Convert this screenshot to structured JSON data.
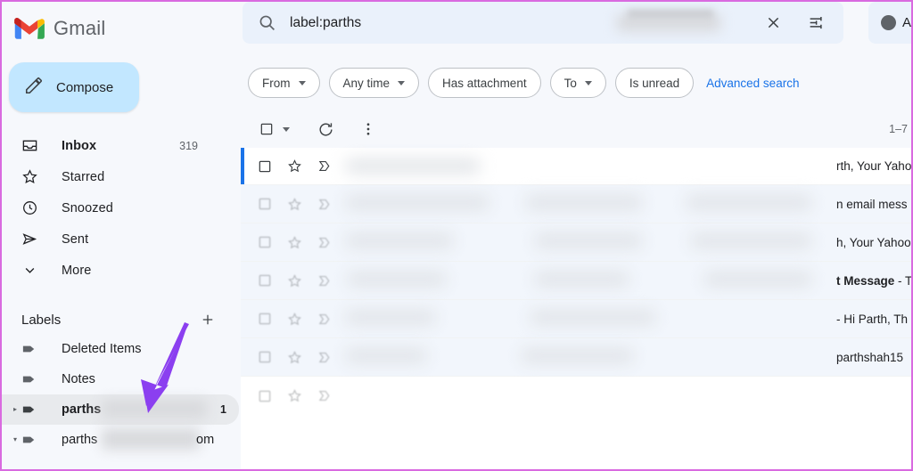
{
  "app": {
    "brand": "Gmail",
    "accent_blue": "#1a73e8",
    "annotation_arrow_color": "#8b3ff0",
    "border_color": "#d96ae0"
  },
  "compose": {
    "label": "Compose",
    "icon": "pencil-icon"
  },
  "sidebar": {
    "nav_items": [
      {
        "label": "Inbox",
        "icon": "inbox-icon",
        "count": "319",
        "active": true
      },
      {
        "label": "Starred",
        "icon": "star-icon",
        "count": "",
        "active": false
      },
      {
        "label": "Snoozed",
        "icon": "clock-icon",
        "count": "",
        "active": false
      },
      {
        "label": "Sent",
        "icon": "send-icon",
        "count": "",
        "active": false
      },
      {
        "label": "More",
        "icon": "chevron-down-icon",
        "count": "",
        "active": false
      }
    ],
    "labels_header": "Labels",
    "create_label_icon": "plus-icon",
    "label_items": [
      {
        "label": "Deleted Items",
        "icon": "label-tag-icon",
        "count": "",
        "caret": "",
        "selected": false
      },
      {
        "label": "Notes",
        "icon": "label-tag-icon",
        "count": "",
        "caret": "",
        "selected": false
      },
      {
        "label": "parths",
        "icon": "label-tag-icon",
        "count": "1",
        "caret": "▸",
        "selected": true,
        "redacted": true
      },
      {
        "label": "parths",
        "suffix": "om",
        "icon": "label-tag-icon",
        "count": "",
        "caret": "▾",
        "selected": false,
        "redacted": true
      }
    ]
  },
  "search": {
    "query": "label:parths",
    "search_icon": "search-icon",
    "clear_icon": "close-icon",
    "tune_icon": "tune-filter-icon",
    "account_label": "Ac"
  },
  "filters": {
    "chips": [
      {
        "label": "From",
        "has_caret": true
      },
      {
        "label": "Any time",
        "has_caret": true
      },
      {
        "label": "Has attachment",
        "has_caret": false
      },
      {
        "label": "To",
        "has_caret": true
      },
      {
        "label": "Is unread",
        "has_caret": false
      }
    ],
    "advanced_search": "Advanced search"
  },
  "toolbar": {
    "select_all_icon": "checkbox-icon",
    "select_caret_icon": "chevron-down-icon",
    "refresh_icon": "refresh-icon",
    "more_icon": "more-vertical-icon",
    "pagination": "1–7"
  },
  "mail_list": {
    "rows": [
      {
        "text": "rth, Your Yaho",
        "bold_prefix": "",
        "first": true
      },
      {
        "text": "n email mess",
        "bold_prefix": "",
        "first": false
      },
      {
        "text": "h, Your Yahoo",
        "bold_prefix": "",
        "first": false
      },
      {
        "text": " - T",
        "bold_prefix": "t Message",
        "first": false
      },
      {
        "text": "- Hi Parth, Th",
        "bold_prefix": "",
        "first": false
      },
      {
        "text": "parthshah15",
        "bold_prefix": "",
        "first": false
      },
      {
        "text": "",
        "bold_prefix": "",
        "first": false
      }
    ]
  }
}
